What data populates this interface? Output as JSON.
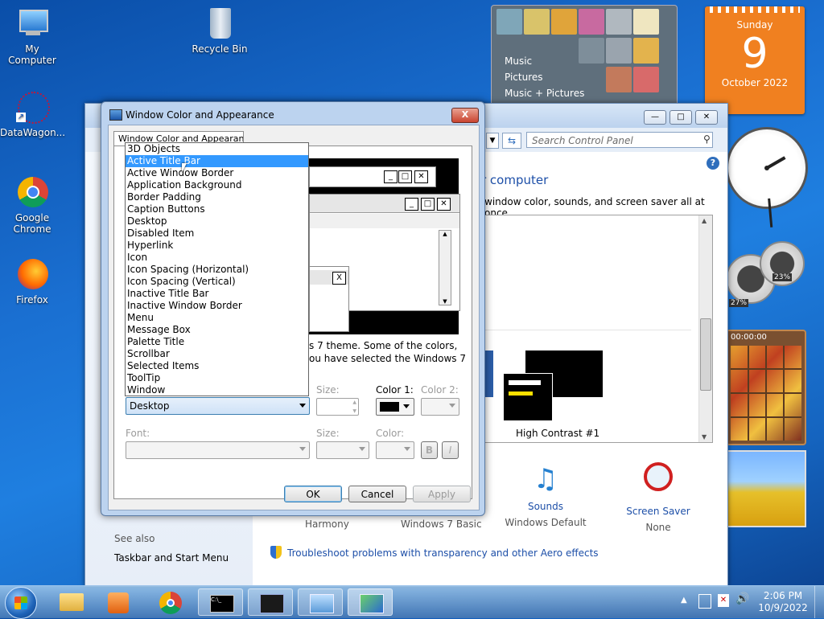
{
  "desktop": {
    "icons": [
      {
        "label": "My Computer"
      },
      {
        "label": "Recycle Bin"
      },
      {
        "label": "DataWagon..."
      },
      {
        "label": "Google Chrome"
      },
      {
        "label": "Firefox"
      }
    ]
  },
  "gadgets": {
    "media": {
      "items": [
        "Music",
        "Pictures",
        "Music + Pictures"
      ]
    },
    "calendar": {
      "weekday": "Sunday",
      "day": "9",
      "month_year": "October 2022"
    },
    "meter": {
      "cpu": "27%",
      "mem": "23%"
    },
    "puzzle": {
      "time": "00:00:00"
    }
  },
  "control_panel": {
    "search_placeholder": "Search Control Panel",
    "heading": "r computer",
    "subheading": "window color, sounds, and screen saver all at once.",
    "theme_name": "High Contrast #1",
    "bottom_items": [
      {
        "title": "Sounds",
        "subtitle": "Windows Default"
      },
      {
        "title": "Screen Saver",
        "subtitle": "None"
      }
    ],
    "bottom_left_labels": [
      "Harmony",
      "Windows 7 Basic"
    ],
    "see_also": "See also",
    "taskbar_link": "Taskbar and Start Menu",
    "troubleshoot_link": "Troubleshoot problems with transparency and other Aero effects"
  },
  "dialog": {
    "title": "Window Color and Appearance",
    "close_label": "X",
    "tab_label": "Window Color and Appearance",
    "preview_labels": {
      "x": "X"
    },
    "text_line1": "s 7 theme.  Some of the colors,",
    "text_line2": "ou have selected the Windows 7",
    "item_field": {
      "size_label": "Size:",
      "color1_label": "Color 1:",
      "color2_label": "Color 2:",
      "selected": "Desktop"
    },
    "font_field": {
      "font_label": "Font:",
      "size_label": "Size:",
      "color_label": "Color:",
      "bold": "B",
      "italic": "I"
    },
    "buttons": {
      "ok": "OK",
      "cancel": "Cancel",
      "apply": "Apply"
    },
    "dropdown_items": [
      "3D Objects",
      "Active Title Bar",
      "Active Window Border",
      "Application Background",
      "Border Padding",
      "Caption Buttons",
      "Desktop",
      "Disabled Item",
      "Hyperlink",
      "Icon",
      "Icon Spacing (Horizontal)",
      "Icon Spacing (Vertical)",
      "Inactive Title Bar",
      "Inactive Window Border",
      "Menu",
      "Message Box",
      "Palette Title",
      "Scrollbar",
      "Selected Items",
      "ToolTip",
      "Window"
    ],
    "highlighted_index": 1
  },
  "taskbar": {
    "time": "2:06 PM",
    "date": "10/9/2022"
  }
}
